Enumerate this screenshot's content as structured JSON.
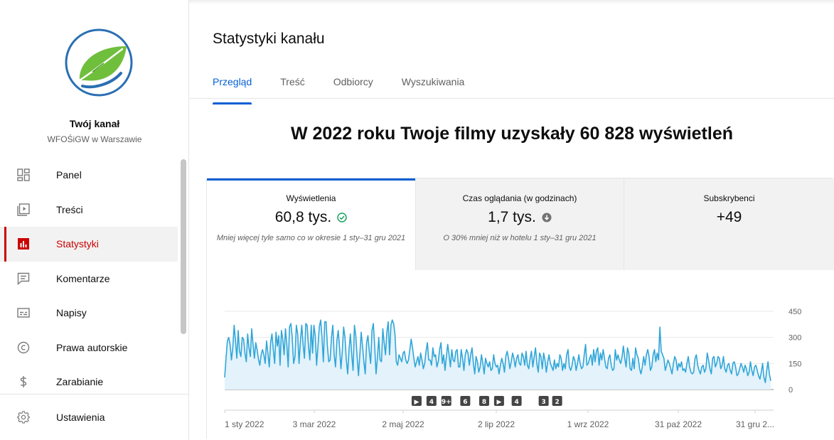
{
  "sidebar": {
    "channel_title": "Twój kanał",
    "channel_subtitle": "WFOŚiGW w Warszawie",
    "items": [
      {
        "label": "Panel",
        "icon": "dashboard-icon"
      },
      {
        "label": "Treści",
        "icon": "content-icon"
      },
      {
        "label": "Statystyki",
        "icon": "analytics-icon",
        "active": true
      },
      {
        "label": "Komentarze",
        "icon": "comments-icon"
      },
      {
        "label": "Napisy",
        "icon": "subtitles-icon"
      },
      {
        "label": "Prawa autorskie",
        "icon": "copyright-icon"
      },
      {
        "label": "Zarabianie",
        "icon": "dollar-icon"
      }
    ],
    "settings_label": "Ustawienia"
  },
  "main": {
    "title": "Statystyki kanału",
    "tabs": [
      {
        "label": "Przegląd",
        "active": true
      },
      {
        "label": "Treść"
      },
      {
        "label": "Odbiorcy"
      },
      {
        "label": "Wyszukiwania"
      }
    ],
    "headline": "W 2022 roku Twoje filmy uzyskały 60 828 wyświetleń"
  },
  "metrics": [
    {
      "label": "Wyświetlenia",
      "value": "60,8 tys.",
      "note": "Mniej więcej tyle samo co w okresie 1 sty–31 gru 2021",
      "status_icon": "check-circle-icon"
    },
    {
      "label": "Czas oglądania (w godzinach)",
      "value": "1,7 tys.",
      "note": "O 30% mniej niż w hotelu 1 sty–31 gru 2021",
      "status_icon": "arrow-down-circle-icon"
    },
    {
      "label": "Subskrybenci",
      "value": "+49",
      "note": ""
    }
  ],
  "colors": {
    "accent": "#065fd4",
    "active_nav": "#cc0000",
    "line": "#30a6d8",
    "area": "#e3f2fb"
  },
  "chart_data": {
    "type": "area",
    "x_start": "1 sty 2022",
    "x_end": "31 gru 2022",
    "ylim": [
      0,
      450
    ],
    "yticks": [
      "450",
      "300",
      "150",
      "0"
    ],
    "xtick_labels": [
      "1 sty 2022",
      "3 mar 2022",
      "2 maj 2022",
      "2 lip 2022",
      "1 wrz 2022",
      "31 paź 2022",
      "31 gru 2..."
    ],
    "grid": true,
    "markers": [
      {
        "label": "▶",
        "day": 142
      },
      {
        "label": "4",
        "day": 153
      },
      {
        "label": "9+",
        "day": 164
      },
      {
        "label": "6",
        "day": 178
      },
      {
        "label": "8",
        "day": 192
      },
      {
        "label": "▶",
        "day": 203
      },
      {
        "label": "4",
        "day": 216
      },
      {
        "label": "3",
        "day": 236
      },
      {
        "label": "2",
        "day": 246
      }
    ],
    "series": [
      {
        "values": [
          70,
          180,
          280,
          300,
          260,
          170,
          240,
          370,
          280,
          180,
          340,
          220,
          190,
          300,
          290,
          210,
          160,
          320,
          240,
          190,
          350,
          260,
          180,
          270,
          230,
          175,
          140,
          200,
          230,
          200,
          150,
          280,
          210,
          130,
          270,
          320,
          230,
          150,
          330,
          250,
          310,
          140,
          340,
          290,
          200,
          350,
          260,
          130,
          360,
          380,
          300,
          150,
          190,
          370,
          320,
          150,
          280,
          370,
          260,
          180,
          380,
          370,
          250,
          170,
          370,
          210,
          370,
          310,
          140,
          250,
          360,
          400,
          300,
          160,
          390,
          390,
          250,
          160,
          170,
          300,
          370,
          200,
          130,
          280,
          340,
          240,
          120,
          220,
          360,
          300,
          170,
          90,
          230,
          320,
          200,
          110,
          370,
          310,
          190,
          80,
          200,
          330,
          250,
          160,
          90,
          270,
          310,
          220,
          150,
          340,
          380,
          250,
          90,
          180,
          300,
          170,
          160,
          350,
          270,
          200,
          330,
          390,
          200,
          370,
          400,
          380,
          320,
          160,
          140,
          200,
          180,
          160,
          210,
          220,
          170,
          150,
          170,
          230,
          290,
          240,
          180,
          130,
          160,
          190,
          140,
          210,
          170,
          120,
          150,
          220,
          270,
          170,
          170,
          140,
          240,
          190,
          200,
          130,
          160,
          230,
          270,
          150,
          200,
          110,
          190,
          260,
          200,
          130,
          230,
          170,
          160,
          220,
          230,
          130,
          130,
          230,
          180,
          110,
          200,
          230,
          210,
          140,
          200,
          240,
          150,
          90,
          190,
          160,
          100,
          130,
          200,
          150,
          90,
          180,
          150,
          130,
          160,
          110,
          120,
          200,
          150,
          130,
          140,
          90,
          140,
          180,
          150,
          100,
          190,
          220,
          180,
          120,
          160,
          210,
          180,
          130,
          180,
          200,
          150,
          140,
          210,
          190,
          140,
          220,
          140,
          120,
          180,
          220,
          130,
          190,
          240,
          150,
          100,
          210,
          190,
          120,
          210,
          170,
          100,
          160,
          200,
          150,
          130,
          110,
          170,
          120,
          150,
          130,
          200,
          180,
          110,
          150,
          120,
          200,
          230,
          130,
          110,
          140,
          190,
          170,
          110,
          150,
          200,
          150,
          120,
          130,
          200,
          260,
          140,
          150,
          180,
          200,
          140,
          230,
          160,
          220,
          240,
          140,
          210,
          170,
          230,
          180,
          130,
          120,
          180,
          200,
          140,
          110,
          120,
          230,
          170,
          200,
          170,
          150,
          190,
          250,
          180,
          130,
          240,
          210,
          120,
          110,
          180,
          120,
          240,
          200,
          180,
          120,
          90,
          130,
          190,
          140,
          200,
          230,
          190,
          110,
          130,
          200,
          230,
          160,
          210,
          170,
          360,
          220,
          200,
          180,
          110,
          140,
          170,
          150,
          120,
          90,
          150,
          190,
          170,
          110,
          150,
          130,
          160,
          110,
          120,
          100,
          150,
          190,
          130,
          100,
          90,
          100,
          180,
          200,
          140,
          110,
          90,
          130,
          140,
          100,
          120,
          210,
          170,
          120,
          90,
          180,
          190,
          130,
          150,
          190,
          180,
          120,
          140,
          190,
          120,
          100,
          140,
          150,
          110,
          90,
          150,
          160,
          130,
          80,
          90,
          120,
          150,
          130,
          100,
          140,
          120,
          80,
          100,
          160,
          110,
          80,
          130,
          140,
          110,
          80,
          60,
          100,
          150,
          70,
          40,
          110,
          160,
          90,
          50
        ]
      }
    ]
  }
}
